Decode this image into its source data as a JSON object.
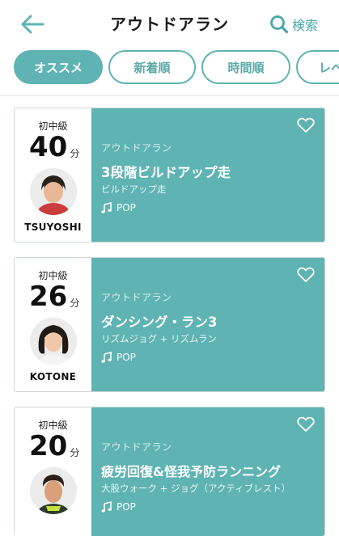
{
  "header": {
    "title": "アウトドアラン",
    "search_label": "検索"
  },
  "tabs": [
    {
      "label": "オススメ",
      "active": true
    },
    {
      "label": "新着順",
      "active": false
    },
    {
      "label": "時間順",
      "active": false
    },
    {
      "label": "レベ",
      "active": false
    }
  ],
  "courses": [
    {
      "level": "初中級",
      "duration": "40",
      "unit": "分",
      "trainer": "TSUYOSHI",
      "category": "アウトドアラン",
      "title": "3段階ビルドアップ走",
      "subtitle": "ビルドアップ走",
      "music": "POP"
    },
    {
      "level": "初中級",
      "duration": "26",
      "unit": "分",
      "trainer": "KOTONE",
      "category": "アウトドアラン",
      "title": "ダンシング・ラン3",
      "subtitle": "リズムジョグ + リズムラン",
      "music": "POP"
    },
    {
      "level": "初中級",
      "duration": "20",
      "unit": "分",
      "trainer": "",
      "category": "アウトドアラン",
      "title": "疲労回復&怪我予防ランニング",
      "subtitle": "大股ウォーク + ジョグ（アクティブレスト）",
      "music": "POP"
    }
  ],
  "colors": {
    "accent": "#5fb3b3",
    "accent_text": "#4aa8a8"
  },
  "icons": {
    "back": "arrow-left-icon",
    "search": "magnifier-icon",
    "favorite": "heart-outline-icon",
    "music": "music-note-icon"
  }
}
